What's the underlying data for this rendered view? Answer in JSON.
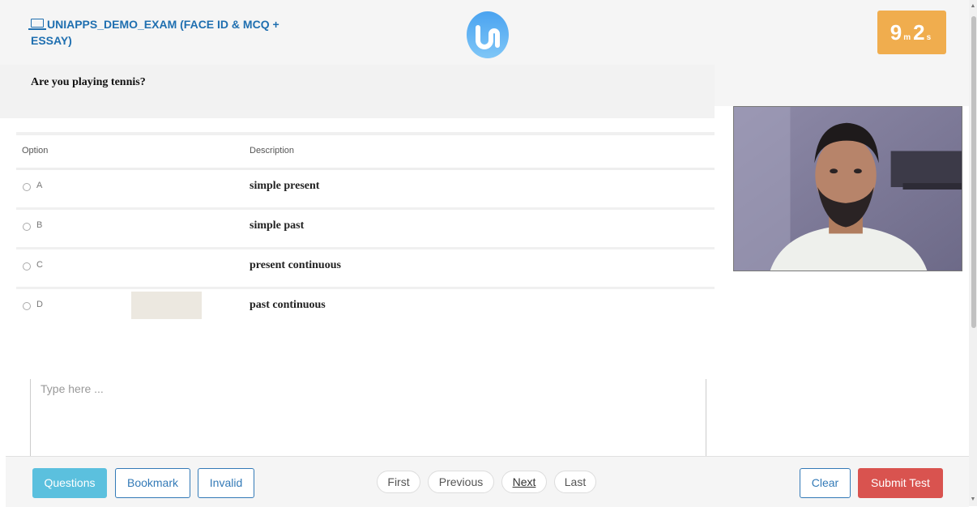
{
  "header": {
    "exam_title": "UNIAPPS_DEMO_EXAM (FACE ID & MCQ + ESSAY)",
    "exam_icon": "laptop-icon",
    "logo": "uniapps-logo",
    "timer": {
      "minutes": "9",
      "minutes_unit": "m",
      "seconds": "2",
      "seconds_unit": "s",
      "color": "#f0ad4e"
    }
  },
  "question": {
    "text": "Are you playing tennis?"
  },
  "options_table": {
    "headers": {
      "option": "Option",
      "description": "Description"
    },
    "rows": [
      {
        "letter": "A",
        "description": "simple present"
      },
      {
        "letter": "B",
        "description": "simple past"
      },
      {
        "letter": "C",
        "description": "present continuous"
      },
      {
        "letter": "D",
        "description": "past continuous"
      }
    ]
  },
  "webcam": {
    "label": "webcam-feed"
  },
  "essay": {
    "placeholder": "Type here ..."
  },
  "footer": {
    "questions": "Questions",
    "bookmark": "Bookmark",
    "invalid": "Invalid",
    "first": "First",
    "previous": "Previous",
    "next": "Next",
    "last": "Last",
    "clear": "Clear",
    "submit": "Submit Test"
  },
  "colors": {
    "accent": "#5bc0de",
    "danger": "#d9534f",
    "primary": "#337ab7",
    "title": "#1f6fb0"
  }
}
